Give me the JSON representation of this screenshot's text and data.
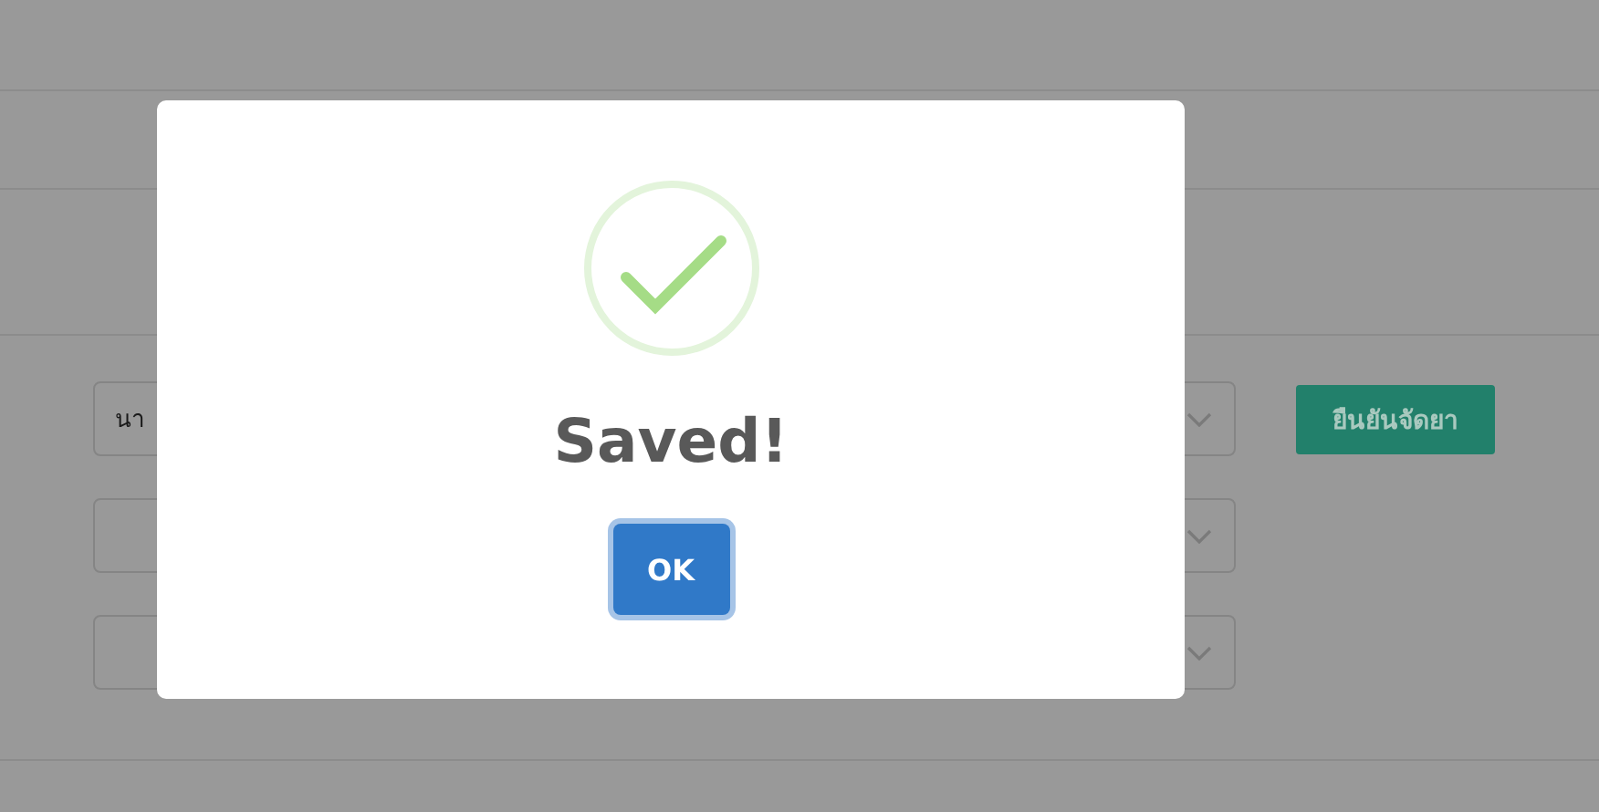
{
  "form": {
    "fields": [
      {
        "kind": "select",
        "value": "นา"
      },
      {
        "kind": "select"
      },
      {
        "kind": "select"
      }
    ],
    "confirm_button": "ยืนยันจัดยา"
  },
  "dialog": {
    "kind": "success",
    "title": "Saved!",
    "button": "OK"
  }
}
